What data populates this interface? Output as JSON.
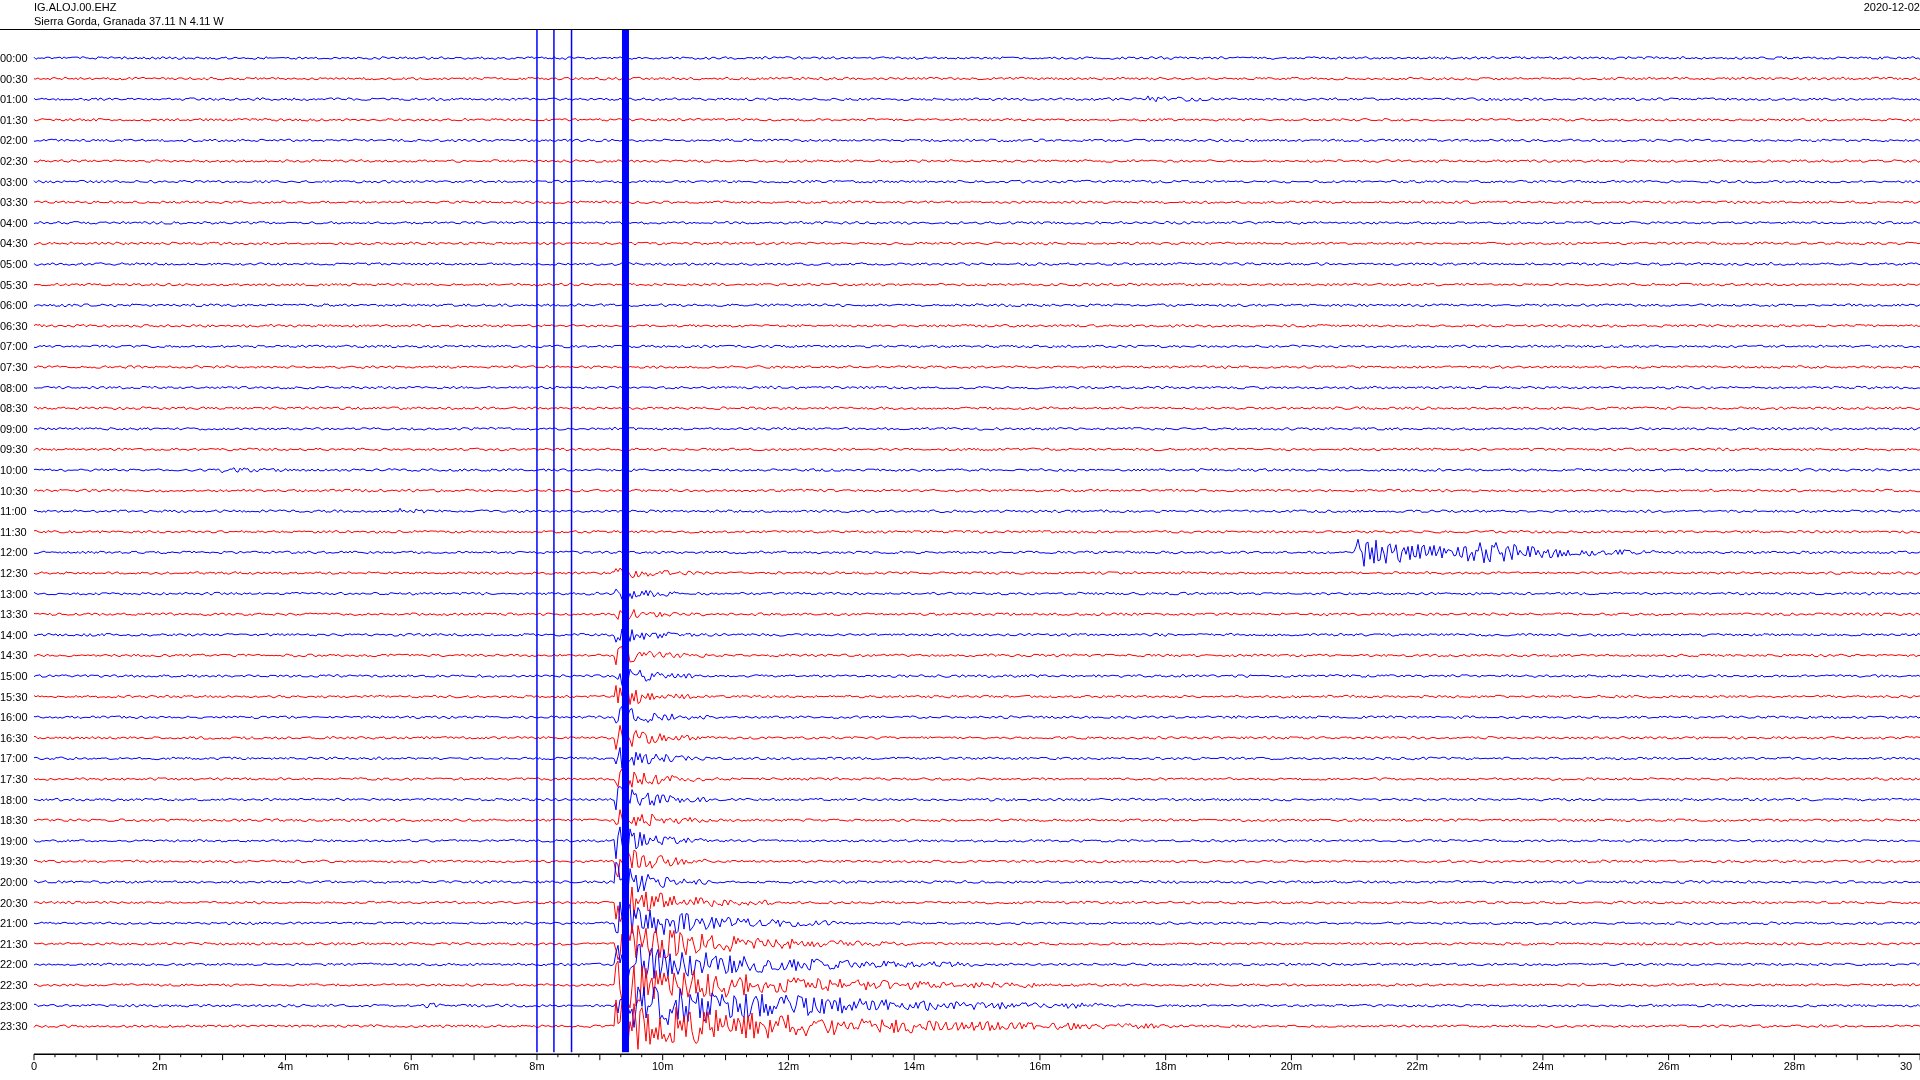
{
  "header": {
    "station": "IG.ALOJ.00.EHZ",
    "location": "Sierra Gorda, Granada  37.11 N 4.11 W",
    "date": "2020-12-02"
  },
  "rows": [
    {
      "time": "00:00",
      "color": "#0000ff"
    },
    {
      "time": "00:30",
      "color": "#ff0000"
    },
    {
      "time": "01:00",
      "color": "#0000ff"
    },
    {
      "time": "01:30",
      "color": "#ff0000"
    },
    {
      "time": "02:00",
      "color": "#0000ff"
    },
    {
      "time": "02:30",
      "color": "#ff0000"
    },
    {
      "time": "03:00",
      "color": "#0000ff"
    },
    {
      "time": "03:30",
      "color": "#ff0000"
    },
    {
      "time": "04:00",
      "color": "#0000ff"
    },
    {
      "time": "04:30",
      "color": "#ff0000"
    },
    {
      "time": "05:00",
      "color": "#0000ff"
    },
    {
      "time": "05:30",
      "color": "#ff0000"
    },
    {
      "time": "06:00",
      "color": "#0000ff"
    },
    {
      "time": "06:30",
      "color": "#ff0000"
    },
    {
      "time": "07:00",
      "color": "#0000ff"
    },
    {
      "time": "07:30",
      "color": "#ff0000"
    },
    {
      "time": "08:00",
      "color": "#0000ff"
    },
    {
      "time": "08:30",
      "color": "#ff0000"
    },
    {
      "time": "09:00",
      "color": "#0000ff"
    },
    {
      "time": "09:30",
      "color": "#ff0000"
    },
    {
      "time": "10:00",
      "color": "#0000ff"
    },
    {
      "time": "10:30",
      "color": "#ff0000"
    },
    {
      "time": "11:00",
      "color": "#0000ff"
    },
    {
      "time": "11:30",
      "color": "#ff0000"
    },
    {
      "time": "12:00",
      "color": "#0000ff"
    },
    {
      "time": "12:30",
      "color": "#ff0000"
    },
    {
      "time": "13:00",
      "color": "#0000ff"
    },
    {
      "time": "13:30",
      "color": "#ff0000"
    },
    {
      "time": "14:00",
      "color": "#0000ff"
    },
    {
      "time": "14:30",
      "color": "#ff0000"
    },
    {
      "time": "15:00",
      "color": "#0000ff"
    },
    {
      "time": "15:30",
      "color": "#ff0000"
    },
    {
      "time": "16:00",
      "color": "#0000ff"
    },
    {
      "time": "16:30",
      "color": "#ff0000"
    },
    {
      "time": "17:00",
      "color": "#0000ff"
    },
    {
      "time": "17:30",
      "color": "#ff0000"
    },
    {
      "time": "18:00",
      "color": "#0000ff"
    },
    {
      "time": "18:30",
      "color": "#ff0000"
    },
    {
      "time": "19:00",
      "color": "#0000ff"
    },
    {
      "time": "19:30",
      "color": "#ff0000"
    },
    {
      "time": "20:00",
      "color": "#0000ff"
    },
    {
      "time": "20:30",
      "color": "#ff0000"
    },
    {
      "time": "21:00",
      "color": "#0000ff"
    },
    {
      "time": "21:30",
      "color": "#ff0000"
    },
    {
      "time": "22:00",
      "color": "#0000ff"
    },
    {
      "time": "22:30",
      "color": "#ff0000"
    },
    {
      "time": "23:00",
      "color": "#0000ff"
    },
    {
      "time": "23:30",
      "color": "#ff0000"
    }
  ],
  "x_axis": {
    "labels": [
      "0",
      "2m",
      "4m",
      "6m",
      "8m",
      "10m",
      "12m",
      "14m",
      "16m",
      "18m",
      "20m",
      "22m",
      "24m",
      "26m",
      "28m",
      "30"
    ]
  }
}
